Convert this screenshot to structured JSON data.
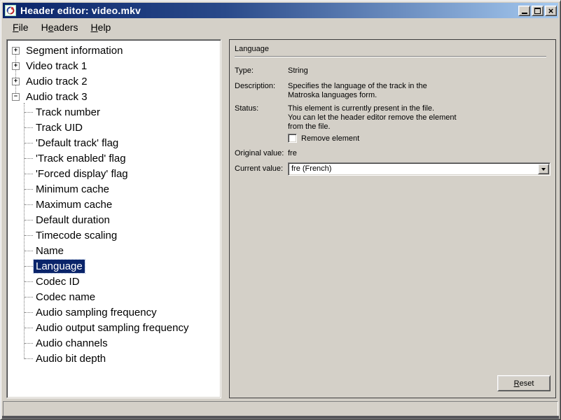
{
  "window": {
    "title": "Header editor: video.mkv",
    "icon": "mkvtoolnix-logo",
    "controls": {
      "minimize": "minimize-window",
      "maximize": "maximize-window",
      "close": "close-window"
    }
  },
  "menu_bar": {
    "items": [
      {
        "pre": "",
        "key": "F",
        "post": "ile"
      },
      {
        "pre": "H",
        "key": "e",
        "post": "aders"
      },
      {
        "pre": "",
        "key": "H",
        "post": "elp"
      }
    ]
  },
  "tree": {
    "items": [
      {
        "label": "Segment information",
        "expanded": false,
        "children": []
      },
      {
        "label": "Video track 1",
        "expanded": false,
        "children": []
      },
      {
        "label": "Audio track 2",
        "expanded": false,
        "children": []
      },
      {
        "label": "Audio track 3",
        "expanded": true,
        "selected_child": "Language",
        "children": [
          "Track number",
          "Track UID",
          "'Default track' flag",
          "'Track enabled' flag",
          "'Forced display' flag",
          "Minimum cache",
          "Maximum cache",
          "Default duration",
          "Timecode scaling",
          "Name",
          "Language",
          "Codec ID",
          "Codec name",
          "Audio sampling frequency",
          "Audio output sampling frequency",
          "Audio channels",
          "Audio bit depth"
        ]
      }
    ]
  },
  "panel": {
    "title": "Language",
    "type_label": "Type:",
    "type_value": "String",
    "description_label": "Description:",
    "description_lines": {
      "0": "Specifies the language of the track in the",
      "1": "Matroska languages form."
    },
    "status_label": "Status:",
    "status_lines": {
      "0": "This element is currently present in the file.",
      "1": "You can let the header editor remove the element",
      "2": "from the file."
    },
    "remove_checkbox": {
      "label": "Remove element",
      "checked": false
    },
    "original_label": "Original value:",
    "original_value": "fre",
    "current_label": "Current value:",
    "current_value": "fre (French)",
    "reset": {
      "pre": "",
      "key": "R",
      "post": "eset"
    }
  },
  "status_bar": {
    "text": ""
  },
  "colors": {
    "window_face": "#d4d0c8",
    "title_gradient_start": "#0a246a",
    "title_gradient_end": "#a6caf0",
    "selection_bg": "#0a246a",
    "selection_text": "#ffffff",
    "tree_bg": "#ffffff",
    "panel_border": "#3c3c3c"
  }
}
